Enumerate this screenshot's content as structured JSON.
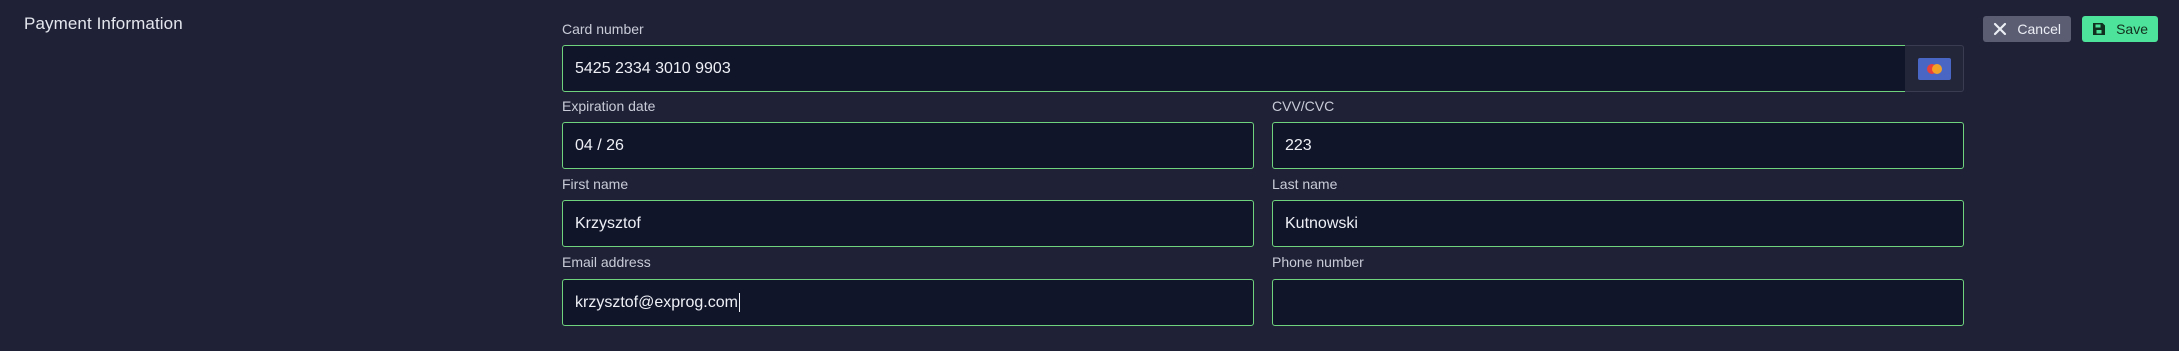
{
  "section": {
    "title": "Payment Information"
  },
  "actions": {
    "cancel_label": "Cancel",
    "save_label": "Save"
  },
  "form": {
    "card_number": {
      "label": "Card number",
      "value": "5425 2334 3010 9903",
      "brand_icon": "mastercard-icon"
    },
    "expiration": {
      "label": "Expiration date",
      "value": "04 / 26"
    },
    "cvv": {
      "label": "CVV/CVC",
      "value": "223"
    },
    "first_name": {
      "label": "First name",
      "value": "Krzysztof"
    },
    "last_name": {
      "label": "Last name",
      "value": "Kutnowski"
    },
    "email": {
      "label": "Email address",
      "value": "krzysztof@exprog.com"
    },
    "phone": {
      "label": "Phone number",
      "value": ""
    }
  },
  "colors": {
    "background": "#1f2136",
    "field_background": "#11152a",
    "field_border": "#6fd27d",
    "save_button": "#4ee39a",
    "cancel_button": "#5b5d73"
  }
}
